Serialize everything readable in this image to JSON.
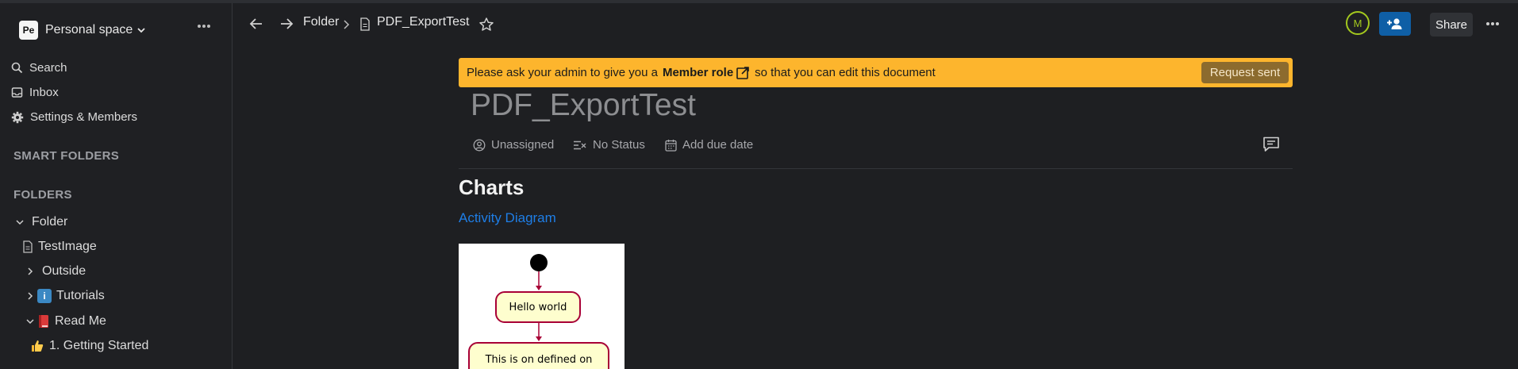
{
  "sidebar": {
    "workspace": {
      "initials": "Pe",
      "name": "Personal space"
    },
    "nav": [
      {
        "label": "Search",
        "icon": "search-icon"
      },
      {
        "label": "Inbox",
        "icon": "inbox-icon"
      },
      {
        "label": "Settings & Members",
        "icon": "gear-icon"
      }
    ],
    "smart_folders_heading": "SMART FOLDERS",
    "folders_heading": "FOLDERS",
    "tree": [
      {
        "label": "Folder",
        "state": "expanded"
      },
      {
        "label": "TestImage",
        "icon": "document-icon"
      },
      {
        "label": "Outside",
        "state": "collapsed"
      },
      {
        "label": "Tutorials",
        "state": "collapsed",
        "emoji": "ℹ️"
      },
      {
        "label": "Read Me",
        "state": "expanded",
        "emoji": "📕"
      },
      {
        "label": "1. Getting Started",
        "emoji": "👍"
      }
    ]
  },
  "header": {
    "breadcrumb_folder": "Folder",
    "breadcrumb_doc": "PDF_ExportTest",
    "avatar_initial": "M",
    "share_label": "Share"
  },
  "banner": {
    "text_before": "Please ask your admin to give you a",
    "role": "Member role",
    "text_after": "so that you can edit this document",
    "button": "Request sent"
  },
  "document": {
    "title": "PDF_ExportTest",
    "assignee": "Unassigned",
    "status": "No Status",
    "due_date": "Add due date",
    "heading": "Charts",
    "link": "Activity Diagram",
    "diagram": {
      "nodes": [
        "Hello world",
        "This is on defined on"
      ]
    }
  },
  "colors": {
    "banner_bg": "#fdb52d",
    "link": "#1e7ee6",
    "invite_button": "#0f5fa6",
    "avatar_ring": "#a3c81e"
  }
}
